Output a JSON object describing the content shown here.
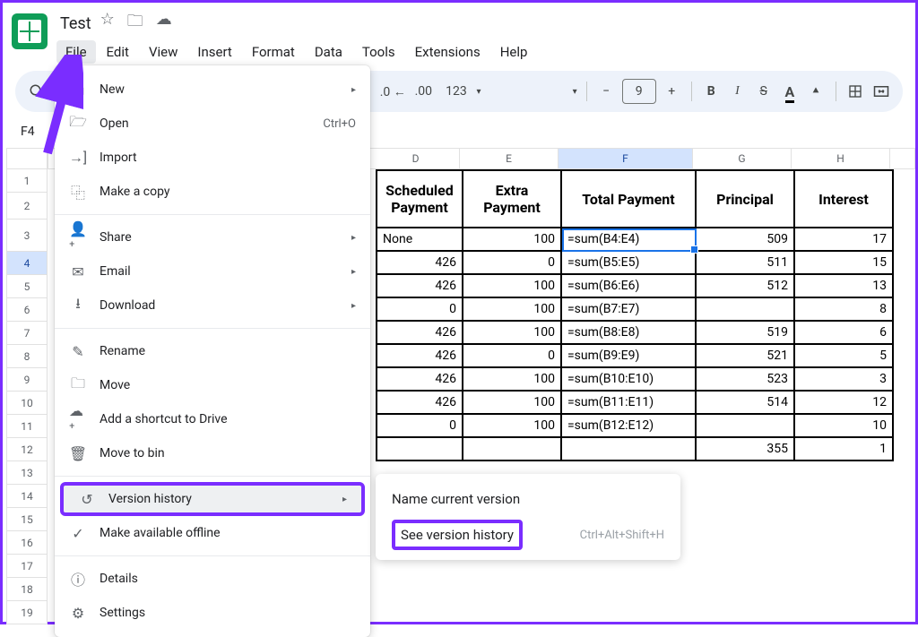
{
  "doc": {
    "title": "Test"
  },
  "menubar": [
    "File",
    "Edit",
    "View",
    "Insert",
    "Format",
    "Data",
    "Tools",
    "Extensions",
    "Help"
  ],
  "toolbar": {
    "format_123": "123",
    "font_size": "9"
  },
  "namebox": "F4",
  "columns_visible": [
    "D",
    "E",
    "F",
    "G",
    "H"
  ],
  "file_menu": {
    "new": "New",
    "open": "Open",
    "open_shortcut": "Ctrl+O",
    "import": "Import",
    "make_copy": "Make a copy",
    "share": "Share",
    "email": "Email",
    "download": "Download",
    "rename": "Rename",
    "move": "Move",
    "add_shortcut": "Add a shortcut to Drive",
    "move_bin": "Move to bin",
    "version_history": "Version history",
    "offline": "Make available offline",
    "details": "Details",
    "settings": "Settings"
  },
  "submenu": {
    "name_version": "Name current version",
    "see_history": "See version history",
    "see_history_shortcut": "Ctrl+Alt+Shift+H"
  },
  "table": {
    "headers": {
      "d": "Scheduled Payment",
      "e": "Extra Payment",
      "f": "Total Payment",
      "g": "Principal",
      "h": "Interest"
    },
    "rows": [
      {
        "d": "None",
        "e": "100",
        "f": "=sum(B4:E4)",
        "g": "509",
        "h": "17"
      },
      {
        "d": "426",
        "e": "0",
        "f": "=sum(B5:E5)",
        "g": "511",
        "h": "15"
      },
      {
        "d": "426",
        "e": "100",
        "f": "=sum(B6:E6)",
        "g": "512",
        "h": "13"
      },
      {
        "d": "0",
        "e": "100",
        "f": "=sum(B7:E7)",
        "g": "",
        "h": "8"
      },
      {
        "d": "426",
        "e": "100",
        "f": "=sum(B8:E8)",
        "g": "519",
        "h": "6"
      },
      {
        "d": "426",
        "e": "0",
        "f": "=sum(B9:E9)",
        "g": "521",
        "h": "5"
      },
      {
        "d": "426",
        "e": "100",
        "f": "=sum(B10:E10)",
        "g": "523",
        "h": "3"
      },
      {
        "d": "426",
        "e": "100",
        "f": "=sum(B11:E11)",
        "g": "514",
        "h": "12"
      },
      {
        "d": "0",
        "e": "100",
        "f": "=sum(B12:E12)",
        "g": "",
        "h": "10"
      },
      {
        "d": "",
        "e": "",
        "f": "",
        "g": "355",
        "h": "1"
      }
    ]
  },
  "chart_data": {
    "type": "table",
    "title": "",
    "columns": [
      "Scheduled Payment",
      "Extra Payment",
      "Total Payment",
      "Principal",
      "Interest"
    ],
    "rows": [
      [
        "None",
        100,
        "=sum(B4:E4)",
        509,
        17
      ],
      [
        426,
        0,
        "=sum(B5:E5)",
        511,
        15
      ],
      [
        426,
        100,
        "=sum(B6:E6)",
        512,
        13
      ],
      [
        0,
        100,
        "=sum(B7:E7)",
        null,
        8
      ],
      [
        426,
        100,
        "=sum(B8:E8)",
        519,
        6
      ],
      [
        426,
        0,
        "=sum(B9:E9)",
        521,
        5
      ],
      [
        426,
        100,
        "=sum(B10:E10)",
        523,
        3
      ],
      [
        426,
        100,
        "=sum(B11:E11)",
        514,
        12
      ],
      [
        0,
        100,
        "=sum(B12:E12)",
        null,
        10
      ],
      [
        null,
        null,
        null,
        355,
        1
      ]
    ]
  }
}
